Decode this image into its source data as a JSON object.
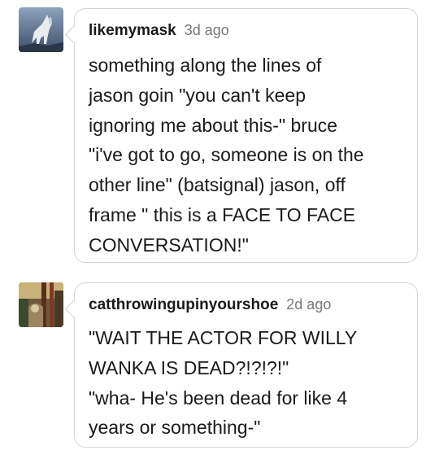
{
  "comments": [
    {
      "username": "likemymask",
      "time": "3d ago",
      "avatar_icon": "wolf-avatar-icon",
      "lines": [
        "something along the lines of",
        "jason goin \"you can't keep",
        "ignoring me about this-\" bruce",
        "\"i've got to go, someone is on the",
        "other line\" (batsignal) jason, off",
        "frame \" this is a FACE TO FACE",
        "CONVERSATION!\""
      ]
    },
    {
      "username": "catthrowingupinyourshoe",
      "time": "2d ago",
      "avatar_icon": "cat-photo-avatar-icon",
      "lines": [
        "\"WAIT THE ACTOR FOR WILLY",
        "WANKA IS DEAD?!?!?!\"",
        "\"wha- He's been dead for like 4",
        "years or something-\""
      ]
    }
  ]
}
